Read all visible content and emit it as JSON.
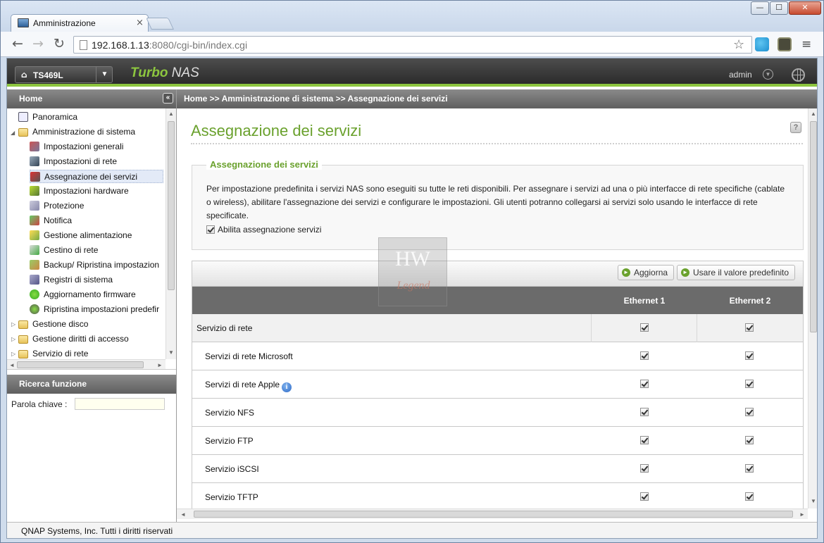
{
  "browser": {
    "tab_title": "Amministrazione",
    "tab_close": "×",
    "url_host": "192.168.1.13",
    "url_rest": ":8080/cgi-bin/index.cgi",
    "back_glyph": "←",
    "forward_glyph": "→",
    "reload_glyph": "↻",
    "star_glyph": "☆",
    "menu_glyph": "≡",
    "window_min": "—",
    "window_max": "☐",
    "window_close": "✕"
  },
  "header": {
    "device_name": "TS469L",
    "brand_turbo": "Turbo",
    "brand_nas": " NAS",
    "user": "admin"
  },
  "sidebar": {
    "title": "Home",
    "collapse_glyph": "«",
    "items": [
      {
        "label": "Panoramica"
      },
      {
        "label": "Amministrazione di sistema"
      },
      {
        "label": "Impostazioni generali"
      },
      {
        "label": "Impostazioni di rete"
      },
      {
        "label": "Assegnazione dei servizi"
      },
      {
        "label": "Impostazioni hardware"
      },
      {
        "label": "Protezione"
      },
      {
        "label": "Notifica"
      },
      {
        "label": "Gestione alimentazione"
      },
      {
        "label": "Cestino di rete"
      },
      {
        "label": "Backup/ Ripristina impostazion"
      },
      {
        "label": "Registri di sistema"
      },
      {
        "label": "Aggiornamento firmware"
      },
      {
        "label": "Ripristina impostazioni predefir"
      },
      {
        "label": "Gestione disco"
      },
      {
        "label": "Gestione diritti di accesso"
      },
      {
        "label": "Servizio di rete"
      }
    ],
    "search_title": "Ricerca funzione",
    "search_label": "Parola chiave :",
    "search_value": ""
  },
  "breadcrumb": "Home >> Amministrazione di sistema >> Assegnazione dei servizi",
  "page": {
    "title": "Assegnazione dei servizi",
    "help": "?",
    "section_legend": "Assegnazione dei servizi",
    "description": "Per impostazione predefinita i servizi NAS sono eseguiti su tutte le reti disponibili. Per assegnare i servizi ad una o più interfacce di rete specifiche (cablate o wireless), abilitare l'assegnazione dei servizi e configurare le impostazioni. Gli utenti potranno collegarsi ai servizi solo usando le interfacce di rete specificate.",
    "enable_label": "Abilita assegnazione servizi",
    "enable_checked": true
  },
  "grid": {
    "refresh_label": "Aggiorna",
    "default_label": "Usare il valore predefinito",
    "columns": [
      "Ethernet 1",
      "Ethernet 2"
    ],
    "rows": [
      {
        "label": "Servizio di rete",
        "group": true,
        "eth1": true,
        "eth2": true
      },
      {
        "label": "Servizi di rete Microsoft",
        "eth1": true,
        "eth2": true
      },
      {
        "label": "Servizi di rete Apple",
        "info": true,
        "eth1": true,
        "eth2": true
      },
      {
        "label": "Servizio NFS",
        "eth1": true,
        "eth2": true
      },
      {
        "label": "Servizio FTP",
        "eth1": true,
        "eth2": true
      },
      {
        "label": "Servizio iSCSI",
        "eth1": true,
        "eth2": true
      },
      {
        "label": "Servizio TFTP",
        "eth1": true,
        "eth2": true
      }
    ]
  },
  "watermark": {
    "top": "HW",
    "bottom": "Legend"
  },
  "footer": "QNAP Systems, Inc. Tutti i diritti riservati",
  "scroll": {
    "up": "▲",
    "down": "▼",
    "left": "◄",
    "right": "►",
    "grip": "III"
  }
}
